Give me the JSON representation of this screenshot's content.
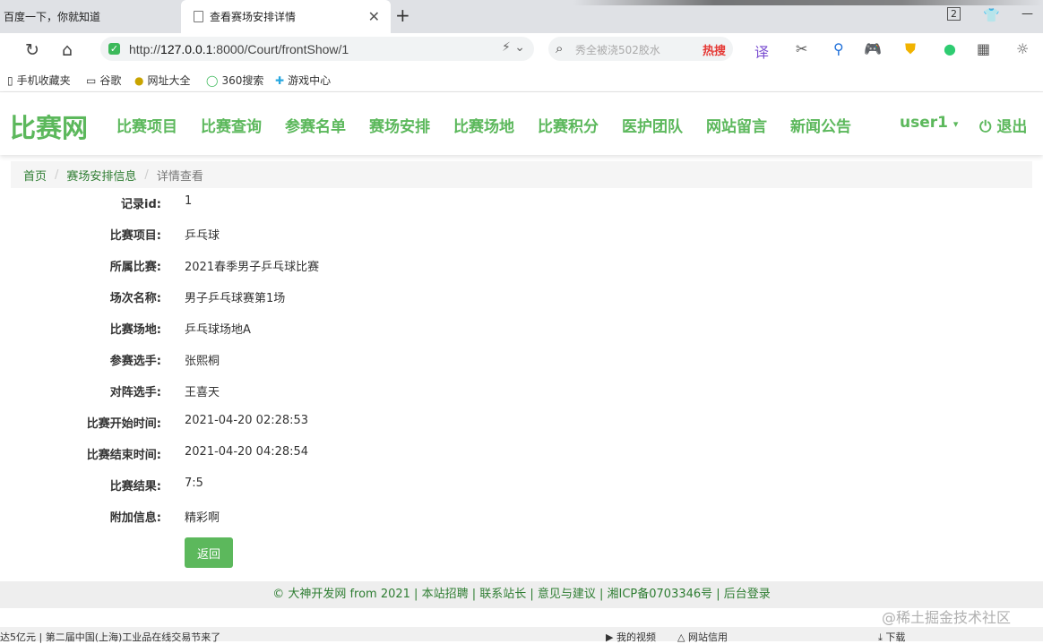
{
  "browser": {
    "tabs": [
      {
        "title": "百度一下，你就知道"
      },
      {
        "title": "查看赛场安排详情"
      }
    ],
    "url_host": "127.0.0.1",
    "url_rest": ":8000/Court/frontShow/1",
    "url_prefix": "http://",
    "search_placeholder": "秀全被浇502胶水",
    "search_hot": "热搜",
    "tab_count": "2",
    "bookmarks": [
      {
        "label": "手机收藏夹"
      },
      {
        "label": "谷歌"
      },
      {
        "label": "网址大全"
      },
      {
        "label": "360搜索"
      },
      {
        "label": "游戏中心"
      }
    ]
  },
  "site": {
    "logo": "比赛网",
    "menu": [
      {
        "label": "比赛项目"
      },
      {
        "label": "比赛查询"
      },
      {
        "label": "参赛名单"
      },
      {
        "label": "赛场安排"
      },
      {
        "label": "比赛场地"
      },
      {
        "label": "比赛积分"
      },
      {
        "label": "医护团队"
      },
      {
        "label": "网站留言"
      },
      {
        "label": "新闻公告"
      }
    ],
    "user": "user1",
    "logout": "退出"
  },
  "breadcrumb": {
    "home": "首页",
    "middle": "赛场安排信息",
    "current": "详情查看"
  },
  "detail": {
    "fields": [
      {
        "label": "记录id:",
        "value": "1"
      },
      {
        "label": "比赛项目:",
        "value": "乒乓球"
      },
      {
        "label": "所属比赛:",
        "value": "2021春季男子乒乓球比赛"
      },
      {
        "label": "场次名称:",
        "value": "男子乒乓球赛第1场"
      },
      {
        "label": "比赛场地:",
        "value": "乒乓球场地A"
      },
      {
        "label": "参赛选手:",
        "value": "张熙桐"
      },
      {
        "label": "对阵选手:",
        "value": "王喜天"
      },
      {
        "label": "比赛开始时间:",
        "value": "2021-04-20 02:28:53"
      },
      {
        "label": "比赛结束时间:",
        "value": "2021-04-20 04:28:54"
      },
      {
        "label": "比赛结果:",
        "value": "7:5"
      },
      {
        "label": "附加信息:",
        "value": "精彩啊"
      }
    ],
    "back_label": "返回"
  },
  "footer": {
    "text": "© 大神开发网 from 2021 | 本站招聘 | 联系站长 | 意见与建议 | 湘ICP备0703346号 | 后台登录"
  },
  "statusbar": {
    "news": "达5亿元 | 第二届中国(上海)工业品在线交易节来了",
    "my_video": "我的视频",
    "site_trust": "网站信用",
    "download": "下载"
  },
  "watermark": "@稀土掘金技术社区",
  "colors": {
    "brand_green": "#5cb85c",
    "link_green": "#2e7d32",
    "footer_bg": "#eeeeee"
  }
}
